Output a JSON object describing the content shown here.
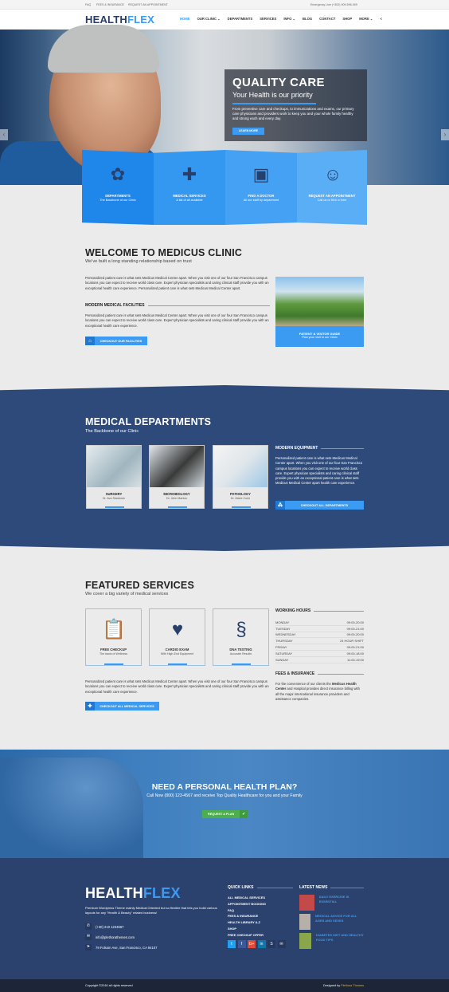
{
  "topbar": {
    "links": [
      "FAQ",
      "FEES & INSURANCE",
      "REQUEST AN APPOINTMENT"
    ],
    "emergency": "Emergency Line (+302) 909-596-909"
  },
  "header": {
    "logo_a": "HEALTH",
    "logo_b": "FLEX",
    "nav": [
      "HOME",
      "OUR CLINIC ⌄",
      "DEPARTMENTS",
      "SERVICES",
      "INFO ⌄",
      "BLOG",
      "CONTACT",
      "SHOP",
      "MORE ⌄"
    ]
  },
  "hero": {
    "title": "QUALITY CARE",
    "subtitle": "Your Health is our priority",
    "text": "From preventive care and checkups, to immunizations and exams, our primary care physicians and providers work to keep you and your whole family healthy and strong each and every day.",
    "button": "LEARN MORE"
  },
  "features": [
    {
      "title": "DEPARTMENTS",
      "sub": "The Backbone of our Clinic",
      "icon": "tree-icon"
    },
    {
      "title": "MEDICAL SERVICES",
      "sub": "A list of all available",
      "icon": "medical-book-icon"
    },
    {
      "title": "FIND A DOCTOR",
      "sub": "All our staff by department",
      "icon": "doctor-badge-icon"
    },
    {
      "title": "REQUEST AN APPOINTMENT",
      "sub": "Call us or fill in a form",
      "icon": "nurse-icon"
    }
  ],
  "welcome": {
    "title": "WELCOME TO MEDICUS CLINIC",
    "subtitle": "We've built a long standing relationship based on trust",
    "p1": "Personalized patient care is what sets Medicus Medical Center apart. When you visit one of our four San Francisco campus locations you can expect to receive world class care. Expert physician specialists and caring clinical staff provide you with an exceptional health care experience. Personalized patient care is what sets Medicus Medical Center apart.",
    "facilities_heading": "MODERN MEDICAL FACILITIES",
    "p2": "Personalized patient care is what sets Medicus Medical Center apart. When you visit one of our four San Francisco campus locations you can expect to receive world class care. Expert physician specialists and caring clinical staff provide you with an exceptional health care experience.",
    "button": "CHECKOUT OUR FACILITIES",
    "guide_title": "PATIENT & VISITOR GUIDE",
    "guide_sub": "Plan your visit to our Clinic"
  },
  "departments": {
    "title": "MEDICAL DEPARTMENTS",
    "subtitle": "The Backbone of our Clinic",
    "cards": [
      {
        "name": "SURGERY",
        "doctor": "Dr. Ava Stankovic"
      },
      {
        "name": "MICROBIOLOGY",
        "doctor": "Dr. John Marlow"
      },
      {
        "name": "PATHOLOGY",
        "doctor": "Dr. Marie Curie"
      }
    ],
    "equipment_heading": "MODERN EQUIPMENT",
    "equipment_text": "Personalized patient care is what sets Medicus Medical Center apart. When you visit one of our four San Francisco campus locations you can expect to receive world class care. Expert physician specialists and caring clinical staff provide you with an exceptional patient care is what sets Medicus Medical Center apart health care experience.",
    "button": "CHECKOUT ALL DEPARTMENTS"
  },
  "services": {
    "title": "FEATURED SERVICES",
    "subtitle": "We cover a big variety of medical services",
    "cards": [
      {
        "name": "FREE CHECKUP",
        "sub": "The basis of Wellness"
      },
      {
        "name": "CARDIO EXAM",
        "sub": "With High-End Equipment"
      },
      {
        "name": "DNA TESTING",
        "sub": "Accurate Results"
      }
    ],
    "text": "Personalized patient care is what sets Medicus Medical Center apart. When you visit one of our four San Francisco campus locations you can expect to receive world class care. Expert physician specialists and caring clinical staff provide you with an exceptional health care experience.",
    "button": "CHECKOUT ALL MEDICAL SERVICES",
    "hours_heading": "WORKING HOURS",
    "hours": [
      [
        "MONDAY",
        "09:00-20:00"
      ],
      [
        "TUESDAY",
        "09:00-21:00"
      ],
      [
        "WEDNESDAY",
        "09:00-20:00"
      ],
      [
        "THURSDAY",
        "24 HOUR SHIFT"
      ],
      [
        "FRIDAY",
        "09:00-21:00"
      ],
      [
        "SATURDAY",
        "09:00-18:00"
      ],
      [
        "SUNDAY",
        "11:00-19:00"
      ]
    ],
    "fees_heading": "FEES & INSURANCE",
    "fees_a": "For the convenience of our clients the ",
    "fees_b": "Medicus Health Center",
    "fees_c": " and Hospital provides direct insurance billing with all the major international insurance providers and assistance companies."
  },
  "cta": {
    "title": "NEED A PERSONAL HEALTH PLAN?",
    "text": "Call Now (800) 123-4567 and receive Top Quality Healthcare for you and your Family",
    "button": "REQUEST A PLAN"
  },
  "footer": {
    "logo_a": "HEALTH",
    "logo_b": "FLEX",
    "desc": "Premium Wordpress Theme mainly Medical Oriented but so flexible that lets you build various layouts for any \"Health & Beauty\" related business!",
    "phone": "(+30) 210 1234567",
    "email": "info@plethorathemes.com",
    "address": "79 Folsom Ave, San Francisco, CA 94107",
    "quick_heading": "QUICK LINKS",
    "quick_links": [
      "ALL MEDICAL SERVICES",
      "APPOINTMENT BOOKING",
      "FAQ",
      "FEES & INSURANCE",
      "HEALTH LIBRARY A-Z",
      "SHOP",
      "FREE CHECKUP OFFER"
    ],
    "news_heading": "LATEST NEWS",
    "news": [
      "DAILY EXERCISE IS ESSENTIAL",
      "MEDICAL ADVICE FOR ALL AGES AND SEXES",
      "DIABETES DIET AND HEALTHY FOOD TIPS"
    ],
    "copyright": "Copyright ©2016 all rights reserved",
    "designed_by": "Designed by ",
    "designer": "Plethora Themes"
  },
  "colors": {
    "accent": "#3b9bf2",
    "navy": "#2d4a7a",
    "footer": "#2c426e"
  }
}
